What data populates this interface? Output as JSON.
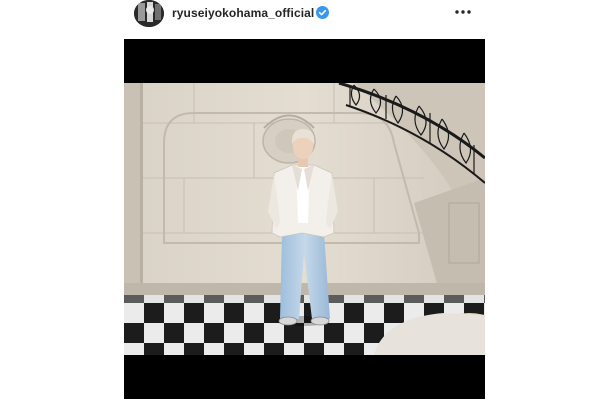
{
  "post": {
    "username": "ryuseiyokohama_official",
    "verified": true,
    "avatar_icon": "profile-avatar",
    "verified_icon": "verified-badge-icon",
    "more_icon": "more-options-icon"
  },
  "media": {
    "type": "photo",
    "letterbox_color": "#000000"
  },
  "colors": {
    "verified_blue": "#3897f0",
    "username_text": "#262626"
  }
}
